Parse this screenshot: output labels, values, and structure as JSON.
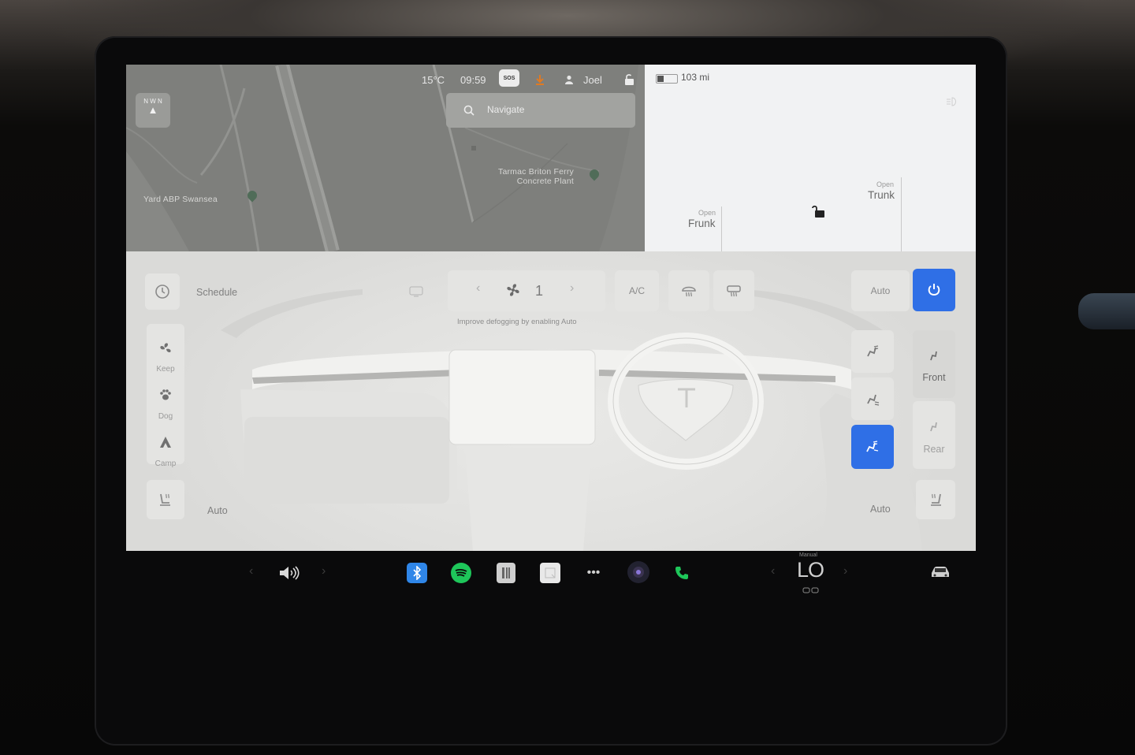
{
  "status_bar": {
    "temperature": "15°C",
    "time": "09:59",
    "sos": "SOS",
    "user": "Joel"
  },
  "navigation": {
    "search_label": "Navigate",
    "places": [
      {
        "name": "Yard ABP Swansea"
      },
      {
        "name_line1": "Tarmac Briton Ferry",
        "name_line2": "Concrete Plant"
      }
    ],
    "compass_letters": "N W N"
  },
  "vehicle": {
    "range": "103 mi",
    "battery_level": 0.35,
    "frunk": {
      "small": "Open",
      "big": "Frunk"
    },
    "trunk": {
      "small": "Open",
      "big": "Trunk"
    }
  },
  "climate": {
    "schedule_label": "Schedule",
    "fan_speed": "1",
    "ac_label": "A/C",
    "defog_hint": "Improve defogging by enabling Auto",
    "auto_label": "Auto",
    "modes": [
      {
        "label": "Keep",
        "icon": "fan-icon"
      },
      {
        "label": "Dog",
        "icon": "paw-icon"
      },
      {
        "label": "Camp",
        "icon": "tent-icon"
      }
    ],
    "seat_heat_left_label": "Auto",
    "seat_heat_right_label": "Auto",
    "front_label": "Front",
    "rear_label": "Rear",
    "power_on": true,
    "accent_color": "#2f6fe6"
  },
  "taskbar": {
    "temperature_mode_label": "Manual",
    "temperature_value": "LO",
    "apps": [
      "volume-icon",
      "bluetooth-icon",
      "spotify-icon",
      "tidal-icon",
      "calendar-icon",
      "more-icon",
      "camera-icon",
      "phone-icon",
      "car-icon"
    ]
  }
}
